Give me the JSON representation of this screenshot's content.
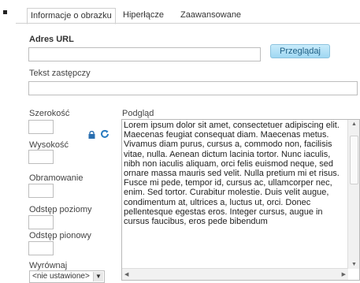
{
  "tabs": [
    {
      "label": "Informacje o obrazku"
    },
    {
      "label": "Hiperłącze"
    },
    {
      "label": "Zaawansowane"
    }
  ],
  "url": {
    "label": "Adres URL",
    "value": "",
    "browse_label": "Przeglądaj"
  },
  "alt_text": {
    "label": "Tekst zastępczy",
    "value": ""
  },
  "width": {
    "label": "Szerokość",
    "value": ""
  },
  "height": {
    "label": "Wysokość",
    "value": ""
  },
  "border": {
    "label": "Obramowanie",
    "value": ""
  },
  "hspace": {
    "label": "Odstęp poziomy",
    "value": ""
  },
  "vspace": {
    "label": "Odstęp pionowy",
    "value": ""
  },
  "align": {
    "label": "Wyrównaj",
    "selected": "<nie ustawione>"
  },
  "preview": {
    "label": "Podgląd",
    "text": "Lorem ipsum dolor sit amet, consectetuer adipiscing elit. Maecenas feugiat consequat diam. Maecenas metus. Vivamus diam purus, cursus a, commodo non, facilisis vitae, nulla. Aenean dictum lacinia tortor. Nunc iaculis, nibh non iaculis aliquam, orci felis euismod neque, sed ornare massa mauris sed velit. Nulla pretium mi et risus. Fusce mi pede, tempor id, cursus ac, ullamcorper nec, enim. Sed tortor. Curabitur molestie. Duis velit augue, condimentum at, ultrices a, luctus ut, orci. Donec pellentesque egestas eros. Integer cursus, augue in cursus faucibus, eros pede bibendum"
  }
}
